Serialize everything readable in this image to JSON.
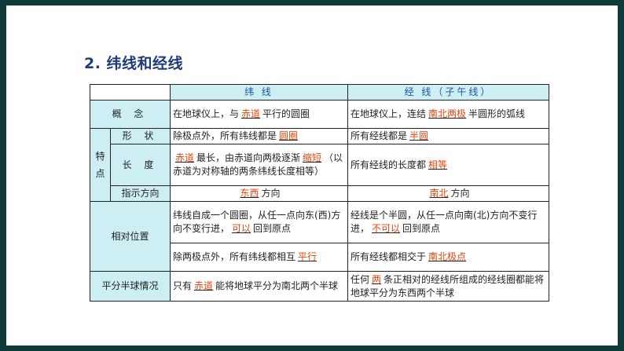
{
  "title": "2. 纬线和经线",
  "headers": {
    "weft": "纬 线",
    "meridian": "经 线（子午线）"
  },
  "labels": {
    "concept": "概 念",
    "feature": "特点",
    "shape": "形 状",
    "length": "长 度",
    "direction": "指示方向",
    "relative": "相对位置",
    "hemisphere": "平分半球情况"
  },
  "rows": {
    "concept": {
      "weft": {
        "pre": "在地球仪上，与",
        "ans": "赤道",
        "post": "平行的圆圈"
      },
      "meridian": {
        "pre": "在地球仪上，连结",
        "ans": "南北两极",
        "post": "半圆形的弧线"
      }
    },
    "shape": {
      "weft": {
        "pre": "除极点外，所有纬线都是",
        "ans": "圆圈"
      },
      "meridian": {
        "pre": "所有经线都是",
        "ans": "半圆"
      }
    },
    "length": {
      "weft": {
        "ans1": "赤道",
        "mid": "最长，由赤道向两极逐渐",
        "ans2": "缩短",
        "post": "（以赤道为对称轴的两条纬线长度相等）"
      },
      "meridian": {
        "pre": "所有经线的长度都",
        "ans": "相等"
      }
    },
    "direction": {
      "weft": {
        "ans": "东西",
        "post": "方向"
      },
      "meridian": {
        "ans": "南北",
        "post": "方向"
      }
    },
    "relative1": {
      "weft": {
        "pre": "纬线自成一个圆圈，从任一点向东(西)方向不变行进，",
        "ans": "可以",
        "post": "回到原点"
      },
      "meridian": {
        "pre": "经线是个半圆，从任一点向南(北)方向不变行进，",
        "ans": "不可以",
        "post": "回到原点"
      }
    },
    "relative2": {
      "weft": {
        "pre": "除两极点外，所有纬线都相互",
        "ans": "平行"
      },
      "meridian": {
        "pre": "所有经线都相交于",
        "ans": "南北极点"
      }
    },
    "hemisphere": {
      "weft": {
        "pre": "只有",
        "ans": "赤道",
        "post": "能将地球平分为南北两个半球"
      },
      "meridian": {
        "pre": "任何",
        "ans": "两",
        "post": "条正相对的经线所组成的经线圈都能将地球平分为东西两个半球"
      }
    }
  },
  "colors": {
    "frame": "#0f3b3a",
    "header_bg": "#cdeef2",
    "answer": "#e2450f",
    "title": "#1f3b7a"
  }
}
